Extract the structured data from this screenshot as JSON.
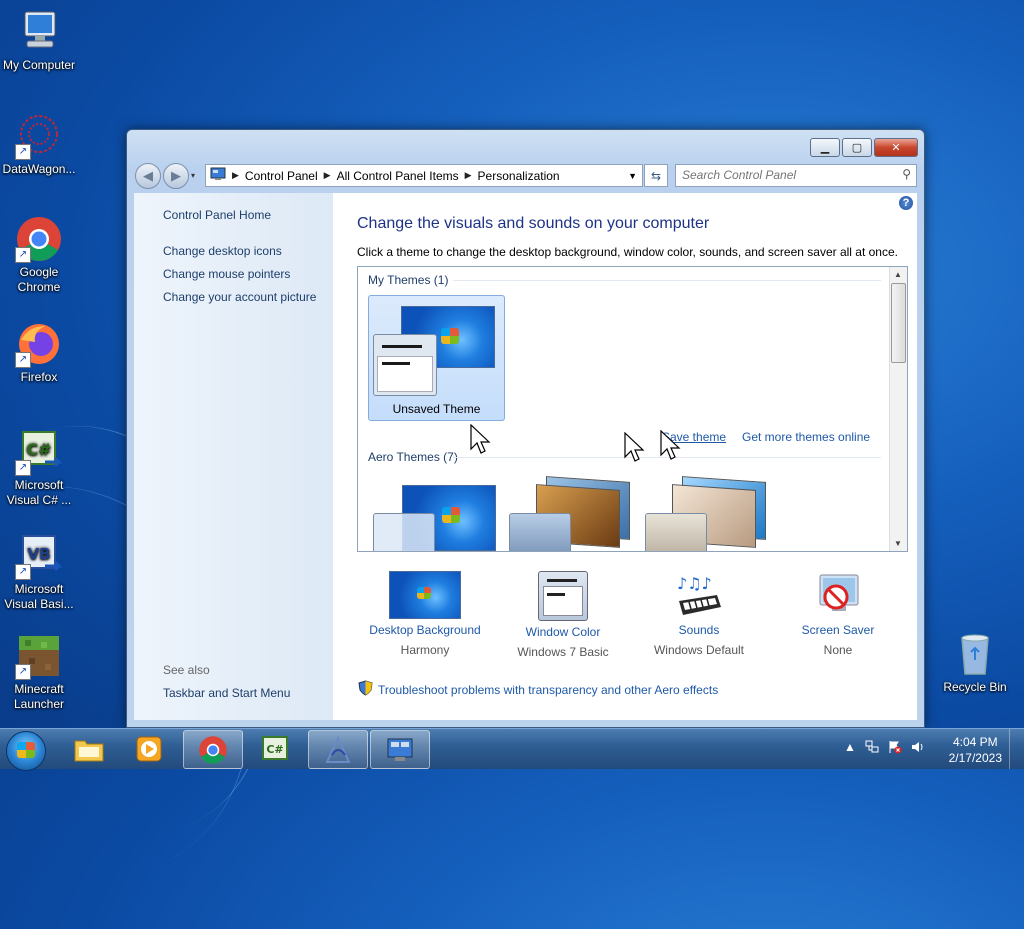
{
  "desktop": {
    "icons": [
      {
        "label": "My Computer"
      },
      {
        "label": "DataWagon..."
      },
      {
        "label": "Google Chrome"
      },
      {
        "label": "Firefox"
      },
      {
        "label": "Microsoft Visual C# ..."
      },
      {
        "label": "Microsoft Visual Basi..."
      },
      {
        "label": "Minecraft Launcher"
      },
      {
        "label": "Recycle Bin"
      }
    ]
  },
  "window": {
    "address": {
      "crumbs": [
        "Control Panel",
        "All Control Panel Items",
        "Personalization"
      ]
    },
    "search": {
      "placeholder": "Search Control Panel"
    },
    "left_pane": {
      "home": "Control Panel Home",
      "links": [
        "Change desktop icons",
        "Change mouse pointers",
        "Change your account picture"
      ],
      "see_also_header": "See also",
      "see_also": [
        "Taskbar and Start Menu"
      ]
    },
    "main": {
      "title": "Change the visuals and sounds on your computer",
      "subtitle": "Click a theme to change the desktop background, window color, sounds, and screen saver all at once.",
      "my_themes_header": "My Themes (1)",
      "unsaved_theme": "Unsaved Theme",
      "save_theme": "Save theme",
      "get_more": "Get more themes online",
      "aero_header": "Aero Themes (7)",
      "bottom": [
        {
          "link": "Desktop Background",
          "value": "Harmony"
        },
        {
          "link": "Window Color",
          "value": "Windows 7 Basic"
        },
        {
          "link": "Sounds",
          "value": "Windows Default"
        },
        {
          "link": "Screen Saver",
          "value": "None"
        }
      ],
      "troubleshoot": "Troubleshoot problems with transparency and other Aero effects"
    }
  },
  "taskbar": {
    "apps": [
      "file-explorer",
      "media-player",
      "chrome",
      "visual-csharp",
      "datawagon",
      "control-panel"
    ],
    "time": "4:04 PM",
    "date": "2/17/2023"
  }
}
